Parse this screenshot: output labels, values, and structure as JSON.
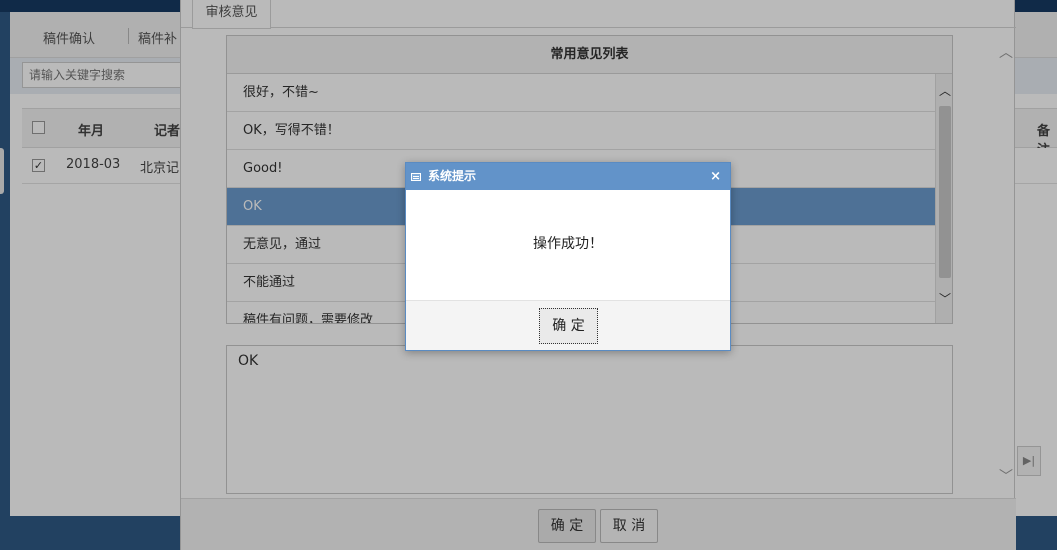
{
  "app": {
    "tabs": [
      "稿件确认",
      "稿件补"
    ],
    "search_placeholder": "请输入关键字搜索",
    "table": {
      "headers": [
        "年月",
        "记者",
        "备注"
      ],
      "row": {
        "checked": true,
        "year_month": "2018-03",
        "reporter": "北京记"
      }
    }
  },
  "review_dialog": {
    "tab_label": "审核意见",
    "panel_title": "常用意见列表",
    "opinions": [
      {
        "text": "很好，不错~",
        "selected": false
      },
      {
        "text": "OK，写得不错！",
        "selected": false
      },
      {
        "text": "Good!",
        "selected": false
      },
      {
        "text": "OK",
        "selected": true
      },
      {
        "text": "无意见，通过",
        "selected": false
      },
      {
        "text": "不能通过",
        "selected": false
      },
      {
        "text": "稿件有问题，需要修改",
        "selected": false
      }
    ],
    "opinion_text": "OK",
    "confirm_label": "确 定",
    "cancel_label": "取 消"
  },
  "message_box": {
    "title": "系统提示",
    "message": "操作成功！",
    "ok_label": "确 定"
  },
  "colors": {
    "title_bar": "#6293c9",
    "selected_row": "#6b9cce",
    "app_frame": "#2f5a86"
  },
  "icons": [
    "window-icon",
    "close-icon",
    "scroll-up-icon",
    "scroll-down-icon",
    "collapse-up-icon",
    "collapse-down-icon"
  ]
}
